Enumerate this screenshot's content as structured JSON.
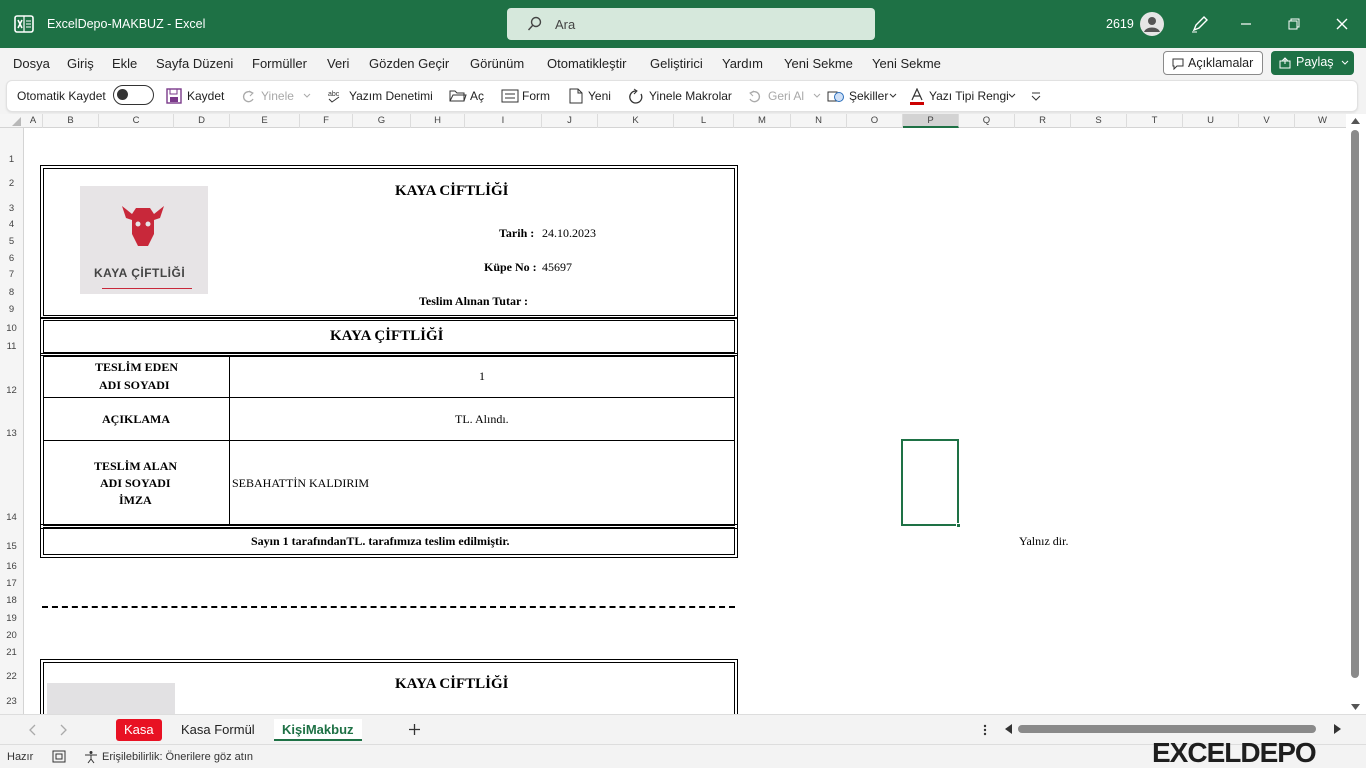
{
  "window": {
    "title": "ExcelDepo-MAKBUZ  -  Excel",
    "search_placeholder": "Ara",
    "counter": "2619"
  },
  "menu": {
    "items": [
      "Dosya",
      "Giriş",
      "Ekle",
      "Sayfa Düzeni",
      "Formüller",
      "Veri",
      "Gözden Geçir",
      "Görünüm",
      "Otomatikleştir",
      "Geliştirici",
      "Yardım",
      "Yeni Sekme",
      "Yeni Sekme"
    ],
    "comments": "Açıklamalar",
    "share": "Paylaş"
  },
  "toolbar": {
    "autosave": "Otomatik Kaydet",
    "save": "Kaydet",
    "redo": "Yinele",
    "spell": "Yazım Denetimi",
    "open": "Aç",
    "form": "Form",
    "new": "Yeni",
    "macros": "Yinele Makrolar",
    "undo": "Geri Al",
    "shapes": "Şekiller",
    "font_color": "Yazı Tipi Rengi"
  },
  "columns": [
    "A",
    "B",
    "C",
    "D",
    "E",
    "F",
    "G",
    "H",
    "I",
    "J",
    "K",
    "L",
    "M",
    "N",
    "O",
    "P",
    "Q",
    "R",
    "S",
    "T",
    "U",
    "V",
    "W"
  ],
  "selected_column": "P",
  "rows": [
    "1",
    "2",
    "3",
    "4",
    "5",
    "6",
    "7",
    "8",
    "9",
    "10",
    "11",
    "12",
    "13",
    "14",
    "15",
    "16",
    "17",
    "18",
    "19",
    "20",
    "21",
    "22",
    "23"
  ],
  "receipt": {
    "company": "KAYA CİFTLİĞİ",
    "logo_text": "KAYA ÇİFTLİĞİ",
    "date_label": "Tarih :",
    "date_value": "24.10.2023",
    "ear_label": "Küpe No :",
    "ear_value": "45697",
    "amount_label": "Teslim Alınan Tutar :",
    "section_title": "KAYA ÇİFTLİĞİ",
    "deliverer_label_1": "TESLİM EDEN",
    "deliverer_label_2": "ADI SOYADI",
    "deliverer_value": "1",
    "desc_label": "AÇIKLAMA",
    "desc_value": "TL. Alındı.",
    "receiver_label_1": "TESLİM ALAN",
    "receiver_label_2": "ADI SOYADI",
    "receiver_label_3": "İMZA",
    "receiver_value": "SEBAHATTİN KALDIRIM",
    "footer": "Sayın 1 tarafındanTL. tarafımıza teslim edilmiştir.",
    "side_text": "Yalnız  dir.",
    "second_company": "KAYA CİFTLİĞİ"
  },
  "sheets": {
    "tabs": [
      "Kasa",
      "Kasa Formül",
      "KişiMakbuz"
    ],
    "active": "KişiMakbuz"
  },
  "status": {
    "ready": "Hazır",
    "accessibility": "Erişilebilirlik: Önerilere göz atın",
    "brand": "EXCELDEPO"
  },
  "colors": {
    "excel_green": "#1e7145",
    "tab_red": "#e81123",
    "logo_red": "#c8283a"
  }
}
